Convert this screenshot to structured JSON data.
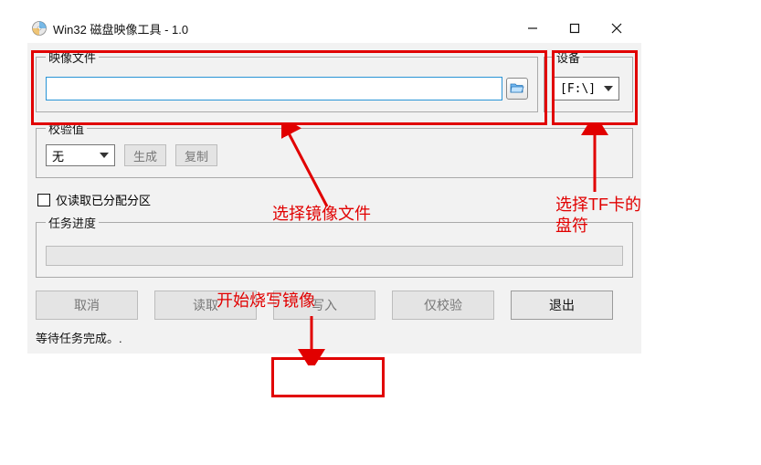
{
  "titlebar": {
    "title": "Win32 磁盘映像工具 - 1.0"
  },
  "image_group": {
    "legend": "映像文件",
    "value": "",
    "browse_icon": "folder-open-icon"
  },
  "device_group": {
    "legend": "设备",
    "selected": "[F:\\]"
  },
  "hash_group": {
    "legend": "校验值",
    "selected": "无",
    "generate_label": "生成",
    "copy_label": "复制"
  },
  "checkbox": {
    "label": "仅读取已分配分区",
    "checked": false
  },
  "progress_group": {
    "legend": "任务进度"
  },
  "buttons": {
    "cancel": "取消",
    "read": "读取",
    "write": "写入",
    "verify": "仅校验",
    "exit": "退出"
  },
  "status": "等待任务完成。.",
  "annotations": {
    "select_image": "选择镜像文件",
    "select_tf": "选择TF卡的盘符",
    "start_write": "开始烧写镜像"
  }
}
